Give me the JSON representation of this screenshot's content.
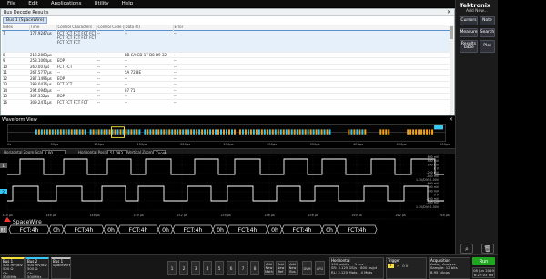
{
  "menu": [
    "File",
    "Edit",
    "Applications",
    "Utility",
    "Help"
  ],
  "brand": {
    "name": "Tektronix",
    "sub": "Add New..."
  },
  "right_buttons": [
    {
      "label": "Cursors"
    },
    {
      "label": "Note"
    },
    {
      "label": "Measure"
    },
    {
      "label": "Search"
    },
    {
      "label": "Results Table"
    },
    {
      "label": "Plot"
    }
  ],
  "results": {
    "title": "Bus Decode Results",
    "close": "✕",
    "tab": "Bus 1 (SpaceWire)",
    "columns": [
      "Index",
      "Time",
      "Control Characters",
      "Control Code (h)",
      "Data (h)",
      "Error"
    ],
    "selected_row": {
      "index": "7",
      "time": "177.9247μs",
      "control": "FCT FCT FCT FCT FCT FCT FCT FCT FCT FCT FCT FCT FCT",
      "code": "--",
      "data": "--",
      "error": "--"
    },
    "rows": [
      {
        "index": "8",
        "time": "213.2863μs",
        "control": "--",
        "code": "--",
        "data": "BB CA CD 17 D8 D9 32",
        "error": "--"
      },
      {
        "index": "9",
        "time": "258.1064μs",
        "control": "EOP",
        "code": "--",
        "data": "--",
        "error": "--"
      },
      {
        "index": "10",
        "time": "260.007μs",
        "control": "FCT FCT",
        "code": "--",
        "data": "--",
        "error": "--"
      },
      {
        "index": "11",
        "time": "267.5777μs",
        "control": "--",
        "code": "--",
        "data": "5A 72 8E",
        "error": "--"
      },
      {
        "index": "12",
        "time": "287.1496μs",
        "control": "EOP",
        "code": "--",
        "data": "--",
        "error": "--"
      },
      {
        "index": "13",
        "time": "288.0436μs",
        "control": "FCT FCT",
        "code": "--",
        "data": "--",
        "error": "--"
      },
      {
        "index": "14",
        "time": "294.0940μs",
        "control": "--",
        "code": "--",
        "data": "87 71",
        "error": "--"
      },
      {
        "index": "15",
        "time": "307.352μs",
        "control": "EOP",
        "code": "--",
        "data": "--",
        "error": "--"
      },
      {
        "index": "16",
        "time": "309.2471μs",
        "control": "FCT FCT FCT FCT",
        "code": "--",
        "data": "--",
        "error": "--"
      }
    ]
  },
  "waveform_view": {
    "title": "Waveform View",
    "close": "✕",
    "overview_ticks": [
      "0s",
      "50μs",
      "100μs",
      "150μs",
      "200μs",
      "250μs",
      "300μs",
      "350μs",
      "400μs",
      "450μs",
      "500μs"
    ],
    "zoom_label": "Horizontal Zoom Scale",
    "zoom_value": "2.00 μs/div",
    "position_label": "Horizontal Position",
    "position_value": "51.083 μs",
    "vertical_zoom_label": "Vertical Zoom",
    "vertical_zoom_value": "Zoom",
    "time_ticks": [
      "144 μs",
      "146 μs",
      "148 μs",
      "150 μs",
      "152 μs",
      "154 μs",
      "156 μs",
      "158 μs",
      "160 μs",
      "162 μs",
      "164 μs"
    ],
    "right_scale_top": [
      "600 mV",
      "400 mV",
      "200 mV",
      "0 V",
      "-200 mV",
      "-400 mV"
    ],
    "right_scale_bot": [
      "600 mV",
      "400 mV",
      "200 mV",
      "0 V",
      "-200 mV",
      "-400 mV"
    ],
    "mid_labels": [
      "1.3V/DIV: 1.00V",
      "1.3V/DIV: 1.00V"
    ],
    "bus_label": "B1",
    "bus_name": "SpaceWire",
    "bus_packets": [
      "FCT:4h",
      "0h",
      "FCT:4h",
      "0h",
      "FCT:4h",
      "0h",
      "FCT:4h",
      "0h",
      "FCT:4h",
      "0h",
      "FCT:4h",
      "0h",
      "FCT:4h"
    ],
    "ch1_label": "1",
    "ch2_label": "2"
  },
  "bottom": {
    "cards": [
      {
        "hdr": "Bus 1",
        "l1": "500 mV/div",
        "l2": "500 Ω",
        "l3": "Ch: 500MHz"
      },
      {
        "hdr": "Bus 2",
        "l1": "500 mV/div",
        "l2": "500 Ω",
        "l3": "Ch: 500MHz"
      },
      {
        "hdr": "Bus 1",
        "l1": "SpaceWire",
        "l2": "",
        "l3": ""
      }
    ],
    "channels": [
      "1",
      "2",
      "3",
      "4",
      "5",
      "6",
      "7",
      "8"
    ],
    "add_buttons": [
      "Add New Math",
      "Add New Ref",
      "Add New Bus"
    ],
    "extra_buttons": [
      "DVM",
      "AFG"
    ],
    "horizontal": {
      "hdr": "Horizontal",
      "l1": "100 μs/div",
      "l2": "SR: 3.125 GS/s",
      "l3": "RL: 3.125 Mpts",
      "l4": "1 ms",
      "l5": "800 ps/pt",
      "l6": "4 Mpts"
    },
    "trigger": {
      "hdr": "Trigger",
      "l1": "0 V"
    },
    "acquisition": {
      "hdr": "Acquisition",
      "l1": "Auto,",
      "l2": "Analyze",
      "l3": "Sample: 12 bits",
      "l4": "8.95 kAcqs"
    },
    "run_label": "Run",
    "date": "08 Jun 2019",
    "time": "6:27:03 PM"
  },
  "colors": {
    "ch1": "#f3e03d",
    "ch2": "#38c8f5",
    "bus": "#e8e8e8",
    "ch1_trace": "#ffffff",
    "ch2_trace": "#ffffff"
  }
}
